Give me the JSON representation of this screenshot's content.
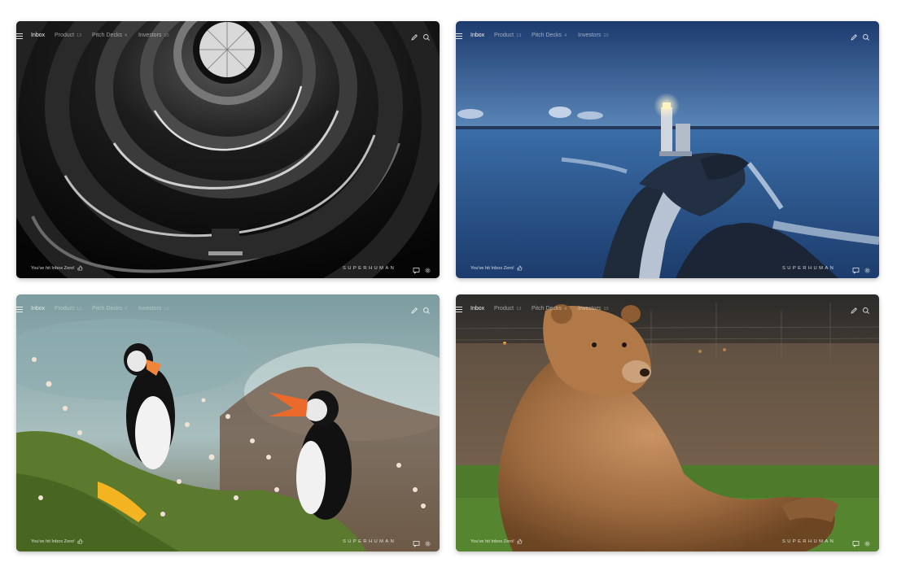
{
  "cards": [
    {
      "wallpaper": "spiral-staircase-black-and-white",
      "tabs": [
        {
          "label": "Inbox",
          "count": ""
        },
        {
          "label": "Product",
          "count": "13"
        },
        {
          "label": "Pitch Decks",
          "count": "4"
        },
        {
          "label": "Investors",
          "count": "10"
        }
      ],
      "status": "You've hit Inbox Zero!",
      "brand": "SUPERHUMAN"
    },
    {
      "wallpaper": "lighthouse-at-dusk",
      "tabs": [
        {
          "label": "Inbox",
          "count": ""
        },
        {
          "label": "Product",
          "count": "13"
        },
        {
          "label": "Pitch Decks",
          "count": "4"
        },
        {
          "label": "Investors",
          "count": "10"
        }
      ],
      "status": "You've hit Inbox Zero!",
      "brand": "SUPERHUMAN"
    },
    {
      "wallpaper": "puffins-on-cliff",
      "tabs": [
        {
          "label": "Inbox",
          "count": ""
        },
        {
          "label": "Product",
          "count": "13"
        },
        {
          "label": "Pitch Decks",
          "count": "4"
        },
        {
          "label": "Investors",
          "count": "10"
        }
      ],
      "status": "You've hit Inbox Zero!",
      "brand": "SUPERHUMAN"
    },
    {
      "wallpaper": "brown-bear-sitting",
      "tabs": [
        {
          "label": "Inbox",
          "count": ""
        },
        {
          "label": "Product",
          "count": "13"
        },
        {
          "label": "Pitch Decks",
          "count": "4"
        },
        {
          "label": "Investors",
          "count": "10"
        }
      ],
      "status": "You've hit Inbox Zero!",
      "brand": "SUPERHUMAN"
    }
  ],
  "icons": {
    "menu": "hamburger-menu-icon",
    "compose": "pencil-icon",
    "search": "magnifier-icon",
    "thumb": "thumbs-up-icon",
    "chat": "message-icon",
    "settings": "gear-icon"
  }
}
